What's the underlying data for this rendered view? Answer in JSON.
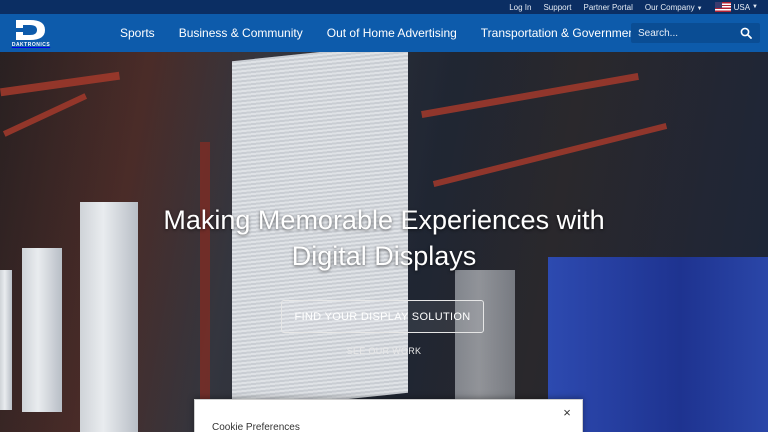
{
  "utility": {
    "login": "Log In",
    "support": "Support",
    "partner_portal": "Partner Portal",
    "our_company": "Our Company",
    "locale": "USA"
  },
  "brand": {
    "name": "DAKTRONICS",
    "logo_letter": "D",
    "color": "#0d5bab"
  },
  "nav": {
    "items": [
      {
        "label": "Sports"
      },
      {
        "label": "Business & Community"
      },
      {
        "label": "Out of Home Advertising"
      },
      {
        "label": "Transportation & Government"
      }
    ],
    "search_placeholder": "Search..."
  },
  "hero": {
    "title_line1": "Making Memorable Experiences with",
    "title_line2": "Digital Displays",
    "cta_primary": "FIND YOUR DISPLAY SOLUTION",
    "cta_secondary": "SEE OUR WORK"
  },
  "cookie": {
    "title": "Cookie Preferences",
    "close_label": "×"
  }
}
